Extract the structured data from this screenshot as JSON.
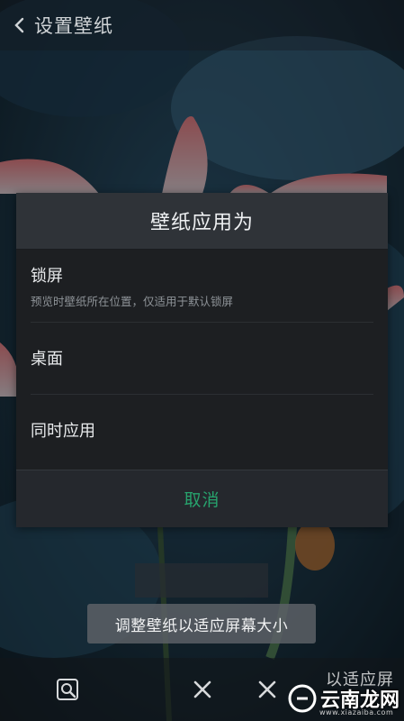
{
  "topbar": {
    "title": "设置壁纸",
    "back_icon": "chevron-left-icon"
  },
  "dialog": {
    "title": "壁纸应用为",
    "options": [
      {
        "label": "锁屏",
        "desc": "预览时壁纸所在位置，仅适用于默认锁屏"
      },
      {
        "label": "桌面"
      },
      {
        "label": "同时应用"
      }
    ],
    "cancel_label": "取消"
  },
  "adjust_button_label": "调整壁纸以适应屏幕大小",
  "bottombar": {
    "icons": [
      "zoom-search-icon",
      "close-icon",
      "close-icon"
    ],
    "partial_label": "以适应屏"
  },
  "watermark": {
    "brand": "云南龙网",
    "url": "www.xiazaiba.com"
  },
  "colors": {
    "accent": "#27a36d",
    "dialog_bg": "#1d1f22",
    "header_bg": "#2f3338"
  }
}
